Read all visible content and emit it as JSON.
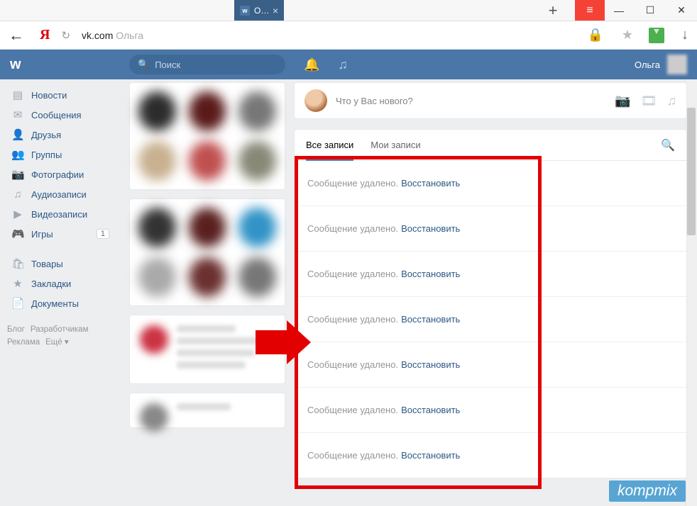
{
  "window": {
    "tab_title": "О…",
    "new_tab": "+",
    "menu": "≡",
    "min": "—",
    "max": "☐",
    "close": "✕"
  },
  "addrbar": {
    "back": "←",
    "yandex": "Я",
    "reload": "↻",
    "domain": "vk.com",
    "page": "Ольга",
    "lock": "🔒",
    "star": "★",
    "dl": "↓"
  },
  "vk": {
    "logo": "w",
    "search_ph": "Поиск",
    "bell": "🔔",
    "music": "♫",
    "user": "Ольга"
  },
  "nav": {
    "news": "Новости",
    "msgs": "Сообщения",
    "friends": "Друзья",
    "groups": "Группы",
    "photos": "Фотографии",
    "audio": "Аудиозаписи",
    "video": "Видеозаписи",
    "games": "Игры",
    "games_badge": "1",
    "goods": "Товары",
    "bookmarks": "Закладки",
    "docs": "Документы"
  },
  "nav_icons": {
    "news": "▤",
    "msgs": "✉",
    "friends": "👤",
    "groups": "👥",
    "photos": "📷",
    "audio": "♫",
    "video": "▶",
    "games": "🎮",
    "goods": "🛍",
    "bookmarks": "★",
    "docs": "📄"
  },
  "footer": {
    "blog": "Блог",
    "dev": "Разработчикам",
    "ads": "Реклама",
    "more": "Ещё ▾"
  },
  "composer": {
    "placeholder": "Что у Вас нового?",
    "cam": "📷",
    "vid": "🎞",
    "mus": "♫"
  },
  "wall_tabs": {
    "all": "Все записи",
    "mine": "Мои записи",
    "search": "🔍"
  },
  "deleted": {
    "msg": "Сообщение удалено.",
    "restore": "Восстановить"
  },
  "watermark": "kompmix"
}
